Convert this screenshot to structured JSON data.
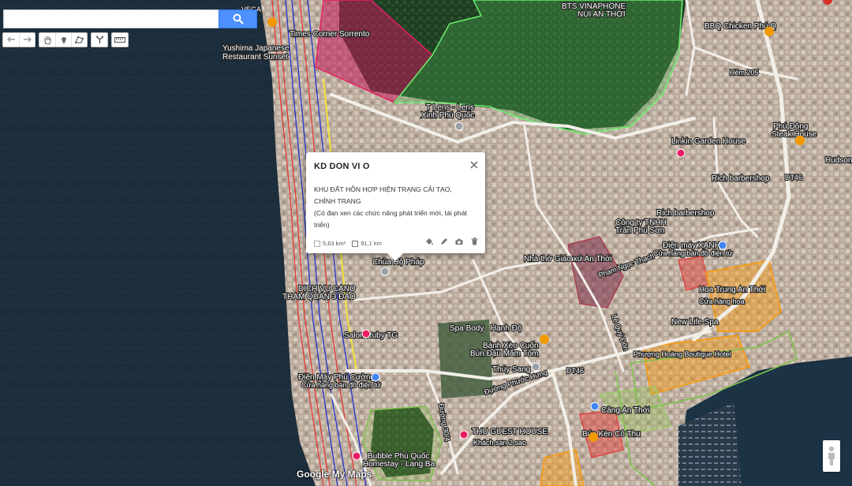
{
  "search": {
    "placeholder": "",
    "value": ""
  },
  "icons": {
    "search": "search-icon",
    "undo": "undo-icon",
    "redo": "redo-icon",
    "hand": "hand-icon",
    "marker": "marker-icon",
    "polygon": "polygon-icon",
    "route": "route-icon",
    "ruler": "ruler-icon",
    "close": "close-icon",
    "paint": "paint-bucket-icon",
    "pen": "pen-icon",
    "camera": "camera-icon",
    "trash": "trash-icon",
    "pegman": "pegman-icon"
  },
  "popup": {
    "title": "KD DON VI O",
    "desc_line1": "KHU ĐẤT HỖN HỢP HIỆN TRẠNG CẢI TẠO,",
    "desc_line2": "CHỈNH TRANG",
    "desc_line3": "(Có đan xen các chức năng phát triển mới, tái phát",
    "desc_line4": "triển)",
    "area": "5,63 km²",
    "perimeter": "91,1 km"
  },
  "map_labels": {
    "l01": "Times Corner Sorrento",
    "l02": "Yushima Japanese",
    "l03": "Restaurant Sunset",
    "l04": "VEGA",
    "l05": "BTS VINAPHONE",
    "l06": "NÚI AN THỚI",
    "l07": "BBQ Chicken Phú Q",
    "l08": "Hẻm 205",
    "l09": "T Lens - Lens",
    "l10": "Xinh Phú Quốc",
    "l11": "Phú Đông",
    "l12": "Steak House",
    "l13": "Linkin Garden House",
    "l14": "Hudson",
    "l15": "Rich barbershop",
    "l16": "Rich barbershop",
    "l17": "Công ty TNHH",
    "l18": "Trần Phú Sơn",
    "l19": "Điện máy XANH",
    "l20": "Cửa hàng bán đồ điện tử",
    "l21": "Nhà thờ Giáo xứ An Thới",
    "l22": "Chùa Hộ Pháp",
    "l23": "Phạm Ngọc Thạch",
    "l24": "DỊCH VỤ CANO",
    "l25": "THAM QUAN 3 ĐẢO",
    "l26": "Hoa Trung An Thới",
    "l27": "Cửa hàng hoa",
    "l28": "Spa Body",
    "l29": "Hạnh Độ",
    "l30": "Salon Ruby TG",
    "l31": "New Life Spa",
    "l32": "Bánh Xèo Cuốn",
    "l33": "Bún Đậu Mắm Tôm",
    "l34": "Lê Quý Đôn",
    "l35": "Thúy Sang",
    "l36": "Phượng Hoàng Boutique Hotel",
    "l37": "Điện Máy Phú Cường",
    "l38": "Cửa hàng bán đồ điện tử",
    "l39": "DT46",
    "l40": "Đường Phước Hưng",
    "l41": "Cảng An Thới",
    "l42": "THU GUEST HOUSE",
    "l43": "Khách sạn 2 sao",
    "l44": "Bún Kèn Cô Thu",
    "l45": "Bubble Phú Quốc",
    "l46": "Homestay - Lang Ba",
    "l47": "Đường 30/4",
    "l48": "DT46"
  },
  "attribution": "Google My Maps",
  "colors": {
    "sea": "#1b2c3a",
    "overlay_green": "#4caf50",
    "overlay_magenta": "#e91e63",
    "overlay_orange": "#ff9800",
    "overlay_red": "#e53935",
    "coast_red": "#e53935",
    "coast_blue": "#2233cc",
    "coast_yellow": "#f4e33a",
    "search_button": "#4d90fe"
  }
}
